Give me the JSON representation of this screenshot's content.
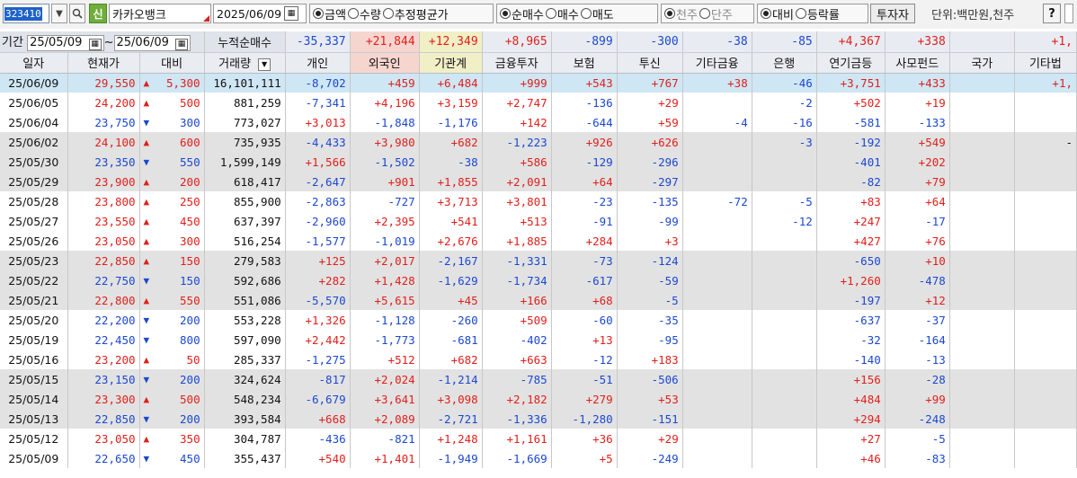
{
  "toolbar": {
    "stock_code": "323410",
    "stock_badge": "신",
    "stock_name": "카카오뱅크",
    "date": "2025/06/09",
    "radio_amount_qty": [
      {
        "label": "금액",
        "selected": true
      },
      {
        "label": "수량",
        "selected": false
      },
      {
        "label": "추정평균가",
        "selected": false
      }
    ],
    "radio_trade": [
      {
        "label": "순매수",
        "selected": true
      },
      {
        "label": "매수",
        "selected": false
      },
      {
        "label": "매도",
        "selected": false
      }
    ],
    "radio_unit_share": [
      {
        "label": "천주",
        "selected": true
      },
      {
        "label": "단주",
        "selected": false
      }
    ],
    "radio_compare": [
      {
        "label": "대비",
        "selected": true
      },
      {
        "label": "등락률",
        "selected": false
      }
    ],
    "investor_button": "투자자",
    "unit_label": "단위:백만원,천주",
    "help_button": "?",
    "icons": [
      "dropdown-arrow-icon",
      "magnifier-icon",
      "calendar-icon"
    ]
  },
  "period": {
    "label": "기간",
    "from": "25/05/09",
    "tilde": "~",
    "to": "25/06/09",
    "cumulative_label": "누적순매수",
    "sums": [
      "-35,337",
      "+21,844",
      "+12,349",
      "+8,965",
      "-899",
      "-300",
      "-38",
      "-85",
      "+4,367",
      "+338",
      "",
      "+1,"
    ]
  },
  "columns": [
    "일자",
    "현재가",
    "대비",
    "거래량",
    "개인",
    "외국인",
    "기관계",
    "금융투자",
    "보험",
    "투신",
    "기타금융",
    "은행",
    "연기금등",
    "사모펀드",
    "국가",
    "기타법"
  ],
  "colors": {
    "up": "#e0201c",
    "down": "#1c48d0",
    "selected_row": "#cfe6f4",
    "grey_row": "#e2e2e2",
    "header_pink": "#f7d5cf",
    "header_yellow": "#f1efc5"
  },
  "rows": [
    {
      "date": "25/06/09",
      "price": "29,550",
      "dir": "up",
      "diff": "5,300",
      "volume": "16,101,111",
      "vals": [
        "-8,702",
        "+459",
        "+6,484",
        "+999",
        "+543",
        "+767",
        "+38",
        "-46",
        "+3,751",
        "+433",
        "",
        "+1,"
      ],
      "style": "sel"
    },
    {
      "date": "25/06/05",
      "price": "24,200",
      "dir": "up",
      "diff": "500",
      "volume": "881,259",
      "vals": [
        "-7,341",
        "+4,196",
        "+3,159",
        "+2,747",
        "-136",
        "+29",
        "",
        "-2",
        "+502",
        "+19",
        "",
        ""
      ],
      "style": "white"
    },
    {
      "date": "25/06/04",
      "price": "23,750",
      "dir": "down",
      "diff": "300",
      "volume": "773,027",
      "vals": [
        "+3,013",
        "-1,848",
        "-1,176",
        "+142",
        "-644",
        "+59",
        "-4",
        "-16",
        "-581",
        "-133",
        "",
        ""
      ],
      "style": "white"
    },
    {
      "date": "25/06/02",
      "price": "24,100",
      "dir": "up",
      "diff": "600",
      "volume": "735,935",
      "vals": [
        "-4,433",
        "+3,980",
        "+682",
        "-1,223",
        "+926",
        "+626",
        "",
        "-3",
        "-192",
        "+549",
        "",
        "-"
      ],
      "style": "grey"
    },
    {
      "date": "25/05/30",
      "price": "23,350",
      "dir": "down",
      "diff": "550",
      "volume": "1,599,149",
      "vals": [
        "+1,566",
        "-1,502",
        "-38",
        "+586",
        "-129",
        "-296",
        "",
        "",
        "-401",
        "+202",
        "",
        ""
      ],
      "style": "grey"
    },
    {
      "date": "25/05/29",
      "price": "23,900",
      "dir": "up",
      "diff": "200",
      "volume": "618,417",
      "vals": [
        "-2,647",
        "+901",
        "+1,855",
        "+2,091",
        "+64",
        "-297",
        "",
        "",
        "-82",
        "+79",
        "",
        ""
      ],
      "style": "grey"
    },
    {
      "date": "25/05/28",
      "price": "23,800",
      "dir": "up",
      "diff": "250",
      "volume": "855,900",
      "vals": [
        "-2,863",
        "-727",
        "+3,713",
        "+3,801",
        "-23",
        "-135",
        "-72",
        "-5",
        "+83",
        "+64",
        "",
        ""
      ],
      "style": "white"
    },
    {
      "date": "25/05/27",
      "price": "23,550",
      "dir": "up",
      "diff": "450",
      "volume": "637,397",
      "vals": [
        "-2,960",
        "+2,395",
        "+541",
        "+513",
        "-91",
        "-99",
        "",
        "-12",
        "+247",
        "-17",
        "",
        ""
      ],
      "style": "white"
    },
    {
      "date": "25/05/26",
      "price": "23,050",
      "dir": "up",
      "diff": "300",
      "volume": "516,254",
      "vals": [
        "-1,577",
        "-1,019",
        "+2,676",
        "+1,885",
        "+284",
        "+3",
        "",
        "",
        "+427",
        "+76",
        "",
        ""
      ],
      "style": "white"
    },
    {
      "date": "25/05/23",
      "price": "22,850",
      "dir": "up",
      "diff": "150",
      "volume": "279,583",
      "vals": [
        "+125",
        "+2,017",
        "-2,167",
        "-1,331",
        "-73",
        "-124",
        "",
        "",
        "-650",
        "+10",
        "",
        ""
      ],
      "style": "grey"
    },
    {
      "date": "25/05/22",
      "price": "22,750",
      "dir": "down",
      "diff": "150",
      "volume": "592,686",
      "vals": [
        "+282",
        "+1,428",
        "-1,629",
        "-1,734",
        "-617",
        "-59",
        "",
        "",
        "+1,260",
        "-478",
        "",
        ""
      ],
      "style": "grey"
    },
    {
      "date": "25/05/21",
      "price": "22,800",
      "dir": "up",
      "diff": "550",
      "volume": "551,086",
      "vals": [
        "-5,570",
        "+5,615",
        "+45",
        "+166",
        "+68",
        "-5",
        "",
        "",
        "-197",
        "+12",
        "",
        ""
      ],
      "style": "grey"
    },
    {
      "date": "25/05/20",
      "price": "22,200",
      "dir": "down",
      "diff": "200",
      "volume": "553,228",
      "vals": [
        "+1,326",
        "-1,128",
        "-260",
        "+509",
        "-60",
        "-35",
        "",
        "",
        "-637",
        "-37",
        "",
        ""
      ],
      "style": "white"
    },
    {
      "date": "25/05/19",
      "price": "22,450",
      "dir": "down",
      "diff": "800",
      "volume": "597,090",
      "vals": [
        "+2,442",
        "-1,773",
        "-681",
        "-402",
        "+13",
        "-95",
        "",
        "",
        "-32",
        "-164",
        "",
        ""
      ],
      "style": "white"
    },
    {
      "date": "25/05/16",
      "price": "23,200",
      "dir": "up",
      "diff": "50",
      "volume": "285,337",
      "vals": [
        "-1,275",
        "+512",
        "+682",
        "+663",
        "-12",
        "+183",
        "",
        "",
        "-140",
        "-13",
        "",
        ""
      ],
      "style": "white"
    },
    {
      "date": "25/05/15",
      "price": "23,150",
      "dir": "down",
      "diff": "200",
      "volume": "324,624",
      "vals": [
        "-817",
        "+2,024",
        "-1,214",
        "-785",
        "-51",
        "-506",
        "",
        "",
        "+156",
        "-28",
        "",
        ""
      ],
      "style": "grey"
    },
    {
      "date": "25/05/14",
      "price": "23,300",
      "dir": "up",
      "diff": "500",
      "volume": "548,234",
      "vals": [
        "-6,679",
        "+3,641",
        "+3,098",
        "+2,182",
        "+279",
        "+53",
        "",
        "",
        "+484",
        "+99",
        "",
        ""
      ],
      "style": "grey"
    },
    {
      "date": "25/05/13",
      "price": "22,850",
      "dir": "down",
      "diff": "200",
      "volume": "393,584",
      "vals": [
        "+668",
        "+2,089",
        "-2,721",
        "-1,336",
        "-1,280",
        "-151",
        "",
        "",
        "+294",
        "-248",
        "",
        ""
      ],
      "style": "grey"
    },
    {
      "date": "25/05/12",
      "price": "23,050",
      "dir": "up",
      "diff": "350",
      "volume": "304,787",
      "vals": [
        "-436",
        "-821",
        "+1,248",
        "+1,161",
        "+36",
        "+29",
        "",
        "",
        "+27",
        "-5",
        "",
        ""
      ],
      "style": "white"
    },
    {
      "date": "25/05/09",
      "price": "22,650",
      "dir": "down",
      "diff": "450",
      "volume": "355,437",
      "vals": [
        "+540",
        "+1,401",
        "-1,949",
        "-1,669",
        "+5",
        "-249",
        "",
        "",
        "+46",
        "-83",
        "",
        ""
      ],
      "style": "white"
    }
  ]
}
